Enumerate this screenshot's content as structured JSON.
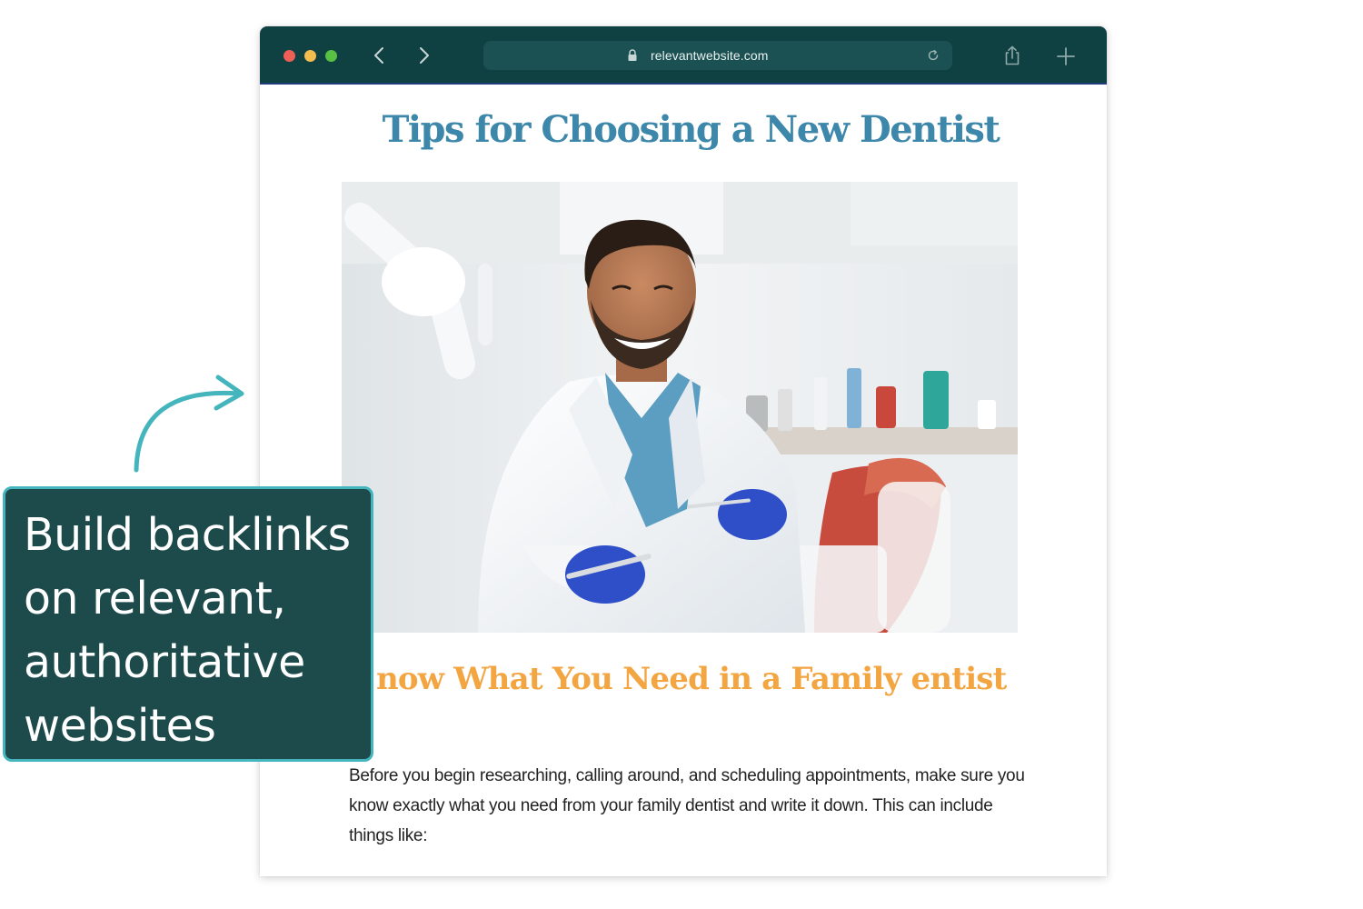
{
  "browser": {
    "url": "relevantwebsite.com",
    "icons": {
      "back": "chevron-left-icon",
      "forward": "chevron-right-icon",
      "lock": "lock-icon",
      "reload": "reload-icon",
      "share": "share-icon",
      "new_tab": "plus-icon"
    },
    "colors": {
      "toolbar": "#0f4143",
      "address_bar": "#1c5153"
    }
  },
  "article": {
    "title": "Tips for Choosing a New Dentist",
    "section_heading": "now What You Need in a Family entist",
    "body": "Before you begin researching, calling around, and scheduling appointments, make sure you know exactly what you need from your family dentist and write it down. This can include things like:",
    "colors": {
      "title": "#3d87ab",
      "section_heading": "#f2a541"
    }
  },
  "callout": {
    "text": "Build backlinks\non relevant,\nauthoritative\nwebsites",
    "colors": {
      "background": "#1d4a4b",
      "border": "#45b5bd",
      "arrow": "#45b5bd"
    }
  }
}
